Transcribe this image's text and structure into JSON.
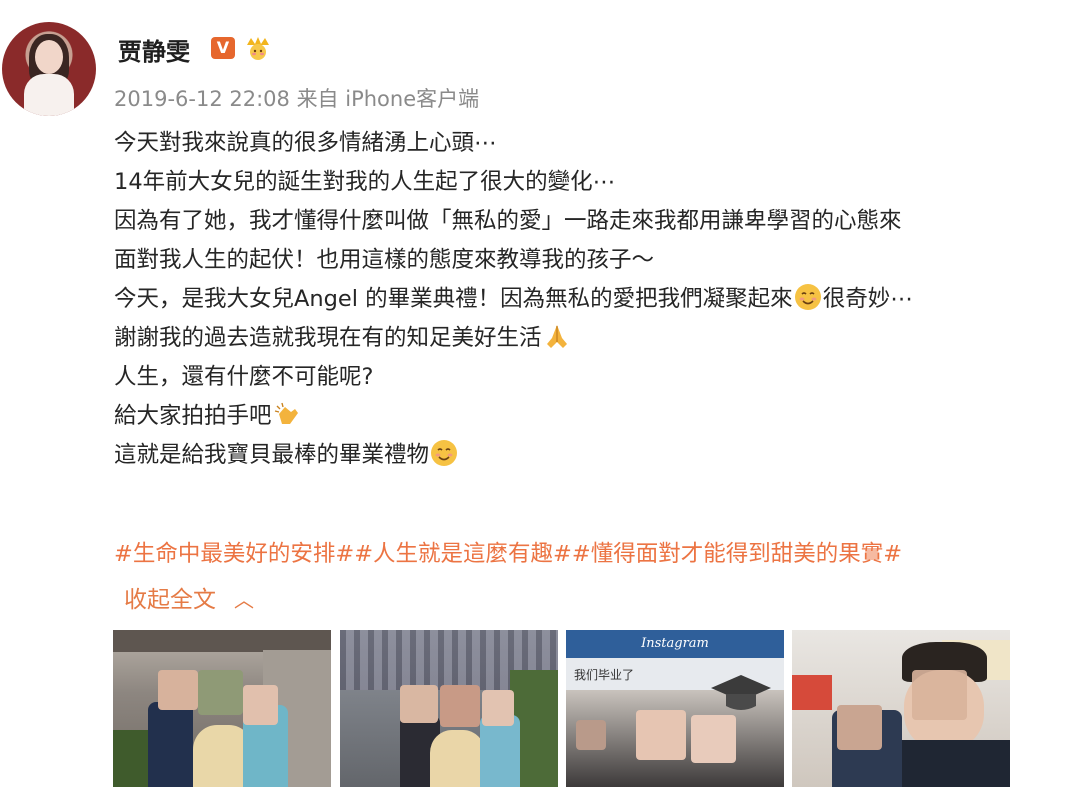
{
  "post": {
    "username": "贾静雯",
    "verified_badge": "V",
    "crown_badge_icon": "crown-face-icon",
    "timestamp": "2019-6-12 22:08",
    "source": "来自 iPhone客户端",
    "lines": {
      "l1": "今天對我來說真的很多情緒湧上心頭⋯",
      "l2": "14年前大女兒的誕生對我的人生起了很大的變化⋯",
      "l3": "因為有了她，我才懂得什麼叫做「無私的愛」一路走來我都用謙卑學習的心態來",
      "l4": "面對我人生的起伏！也用這樣的態度來教導我的孩子～",
      "l5a": "今天，是我大女兒Angel 的畢業典禮！因為無私的愛把我們凝聚起來",
      "l5b": "很奇妙⋯",
      "l6": "謝謝我的過去造就我現在有的知足美好生活",
      "l7": "人生，還有什麼不可能呢?",
      "l8": "給大家拍拍手吧",
      "l9": "這就是給我寶貝最棒的畢業禮物"
    },
    "hashtags": "#生命中最美好的安排##人生就是這麼有趣##懂得面對才能得到甜美的果實#",
    "collapse_label": "收起全文",
    "collapse_icon": "chevron-up-icon",
    "photo3_app_label": "Instagram",
    "photo3_caption": "我们毕业了"
  },
  "colors": {
    "link_orange": "#ec7443",
    "meta_gray": "#8a8a8a",
    "verified_orange": "#e6672d"
  }
}
